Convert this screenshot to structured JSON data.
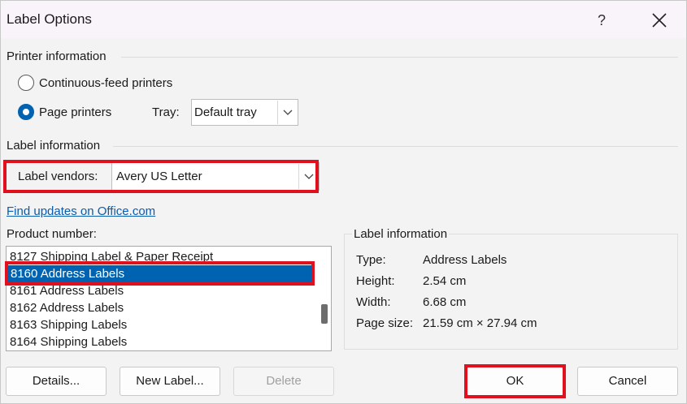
{
  "window": {
    "title": "Label Options",
    "help": "?"
  },
  "printer_info": {
    "heading": "Printer information",
    "continuous_label": "Continuous-feed printers",
    "page_label": "Page printers",
    "tray_label": "Tray:",
    "tray_value": "Default tray"
  },
  "label_info": {
    "heading": "Label information",
    "vendors_label": "Label vendors:",
    "vendors_value": "Avery US Letter",
    "updates_link": "Find updates on Office.com"
  },
  "product": {
    "label": "Product number:",
    "items": [
      "8127 Shipping Label & Paper Receipt",
      "8160 Address Labels",
      "8161 Address Labels",
      "8162 Address Labels",
      "8163 Shipping Labels",
      "8164 Shipping Labels"
    ],
    "selected": "8160 Address Labels"
  },
  "details": {
    "heading": "Label information",
    "type_key": "Type:",
    "type_val": "Address Labels",
    "height_key": "Height:",
    "height_val": "2.54 cm",
    "width_key": "Width:",
    "width_val": "6.68 cm",
    "page_key": "Page size:",
    "page_val": "21.59 cm × 27.94 cm"
  },
  "buttons": {
    "details": "Details...",
    "new_label": "New Label...",
    "delete": "Delete",
    "ok": "OK",
    "cancel": "Cancel"
  },
  "colors": {
    "accent": "#0063b1",
    "highlight": "#e0101e",
    "link": "#0b5cad"
  }
}
